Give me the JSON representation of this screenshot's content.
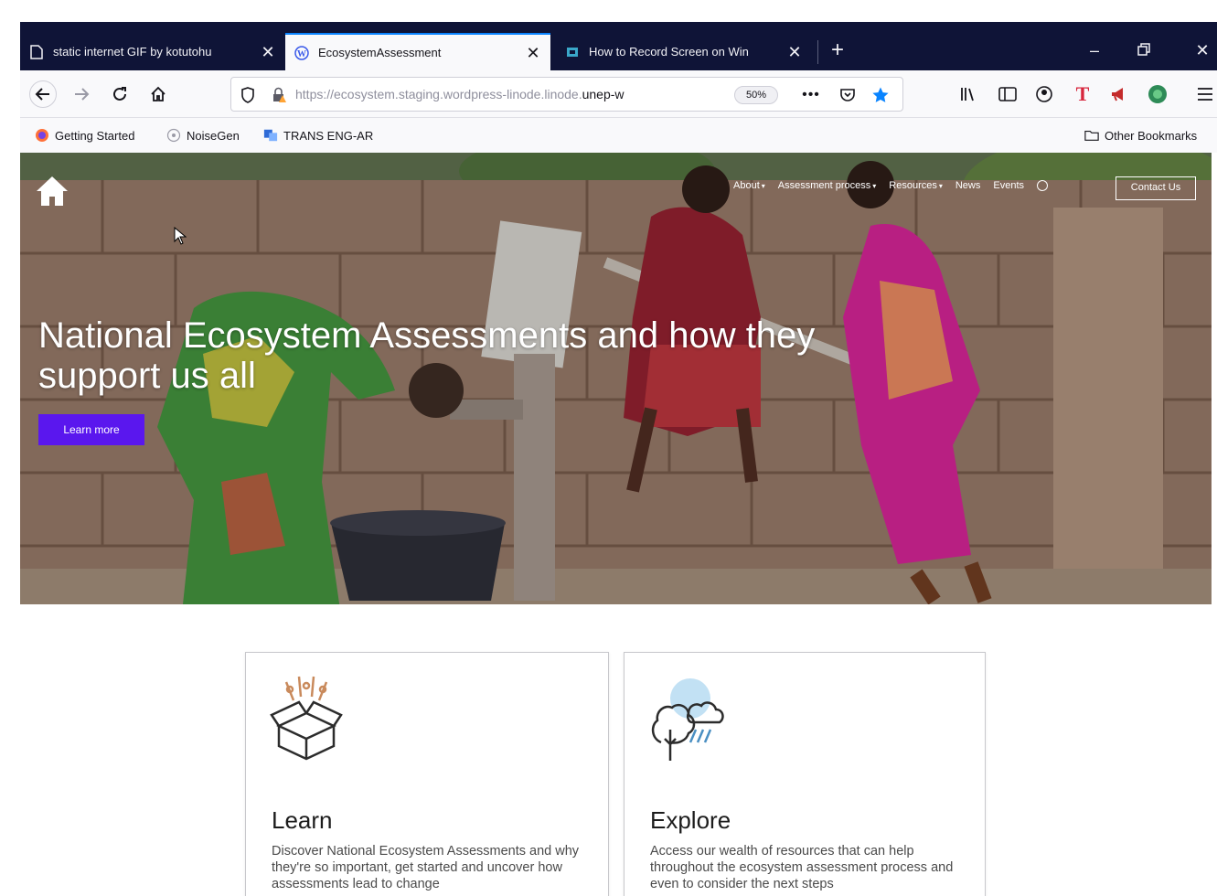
{
  "browser": {
    "tabs": [
      {
        "title": "static internet GIF by kotutohu",
        "active": false,
        "icon": "page-icon"
      },
      {
        "title": "EcosystemAssessment",
        "active": true,
        "icon": "wordpress-icon"
      },
      {
        "title": "How to Record Screen on Win",
        "active": false,
        "icon": "site-icon"
      }
    ],
    "url": {
      "prefix": "https://ecosystem.staging.wordpress-linode.linode.",
      "domain": "unep-w",
      "zoom": "50%"
    },
    "bookmarks": [
      {
        "label": "Getting Started",
        "icon": "firefox-icon"
      },
      {
        "label": "NoiseGen",
        "icon": "noisegen-icon"
      },
      {
        "label": "TRANS ENG-AR",
        "icon": "translate-icon"
      }
    ],
    "other_bookmarks": "Other Bookmarks"
  },
  "site": {
    "nav": [
      {
        "label": "About",
        "dropdown": true
      },
      {
        "label": "Assessment process",
        "dropdown": true
      },
      {
        "label": "Resources",
        "dropdown": true
      },
      {
        "label": "News",
        "dropdown": false
      },
      {
        "label": "Events",
        "dropdown": false
      }
    ],
    "contact_label": "Contact Us",
    "hero": {
      "title": "National Ecosystem Assessments and how they support us all",
      "button": "Learn more"
    },
    "cards": [
      {
        "title": "Learn",
        "description": "Discover National Ecosystem Assessments and why they're so important, get started and uncover how assessments lead to change",
        "icon": "open-box-icon"
      },
      {
        "title": "Explore",
        "description": "Access our wealth of resources that can help throughout the ecosystem assessment process and even to consider the next steps",
        "icon": "tree-weather-icon"
      }
    ]
  },
  "colors": {
    "tabbar": "#0f1437",
    "accent_purple": "#5a17ee",
    "tab_highlight": "#0a84ff"
  }
}
